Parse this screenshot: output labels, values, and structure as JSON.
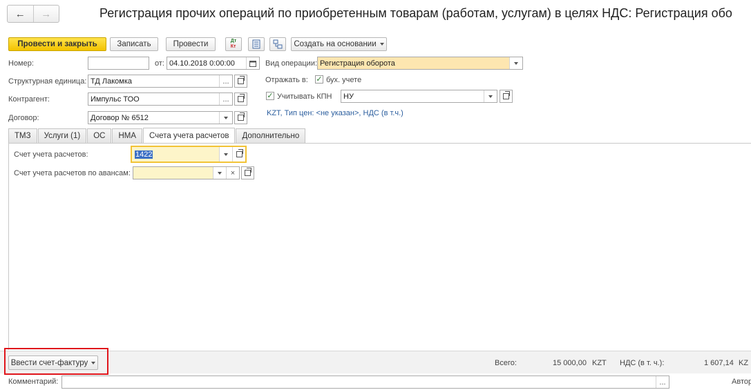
{
  "window": {
    "title": "Регистрация прочих операций по приобретенным товарам (работам, услугам) в целях НДС: Регистрация обо",
    "back_icon": "arrow-left-icon",
    "forward_icon": "arrow-right-icon"
  },
  "toolbar": {
    "post_close": "Провести и закрыть",
    "save": "Записать",
    "post": "Провести",
    "dt_kt_top": "Дт",
    "dt_kt_bottom": "Кт",
    "create_based_on": "Создать на основании"
  },
  "form": {
    "number_label": "Номер:",
    "number_value": "",
    "date_label": "от:",
    "date_value": "04.10.2018  0:00:00",
    "unit_label": "Структурная единица:",
    "unit_value": "ТД Лакомка",
    "contractor_label": "Контрагент:",
    "contractor_value": "Импульс ТОО",
    "contract_label": "Договор:",
    "contract_value": "Договор № 6512",
    "operation_label": "Вид операции:",
    "operation_value": "Регистрация оборота",
    "reflect_label": "Отражать в:",
    "reflect_accounting_label": "бух. учете",
    "reflect_accounting_checked": true,
    "kpn_label": "Учитывать КПН",
    "kpn_checked": true,
    "kpn_value": "НУ",
    "price_info_link": "KZT, Тип цен: <не указан>, НДС (в т.ч.)"
  },
  "tabs": [
    {
      "label": "ТМЗ"
    },
    {
      "label": "Услуги (1)"
    },
    {
      "label": "ОС"
    },
    {
      "label": "НМА"
    },
    {
      "label": "Счета учета расчетов"
    },
    {
      "label": "Дополнительно"
    }
  ],
  "active_tab": 4,
  "settlement": {
    "account_label": "Счет учета расчетов:",
    "account_value": "1422",
    "advance_label": "Счет учета расчетов по авансам:",
    "advance_value": ""
  },
  "footer": {
    "invoice_button": "Ввести счет-фактуру",
    "total_label": "Всего:",
    "total_value": "15 000,00",
    "currency": "KZT",
    "vat_label": "НДС (в т. ч.):",
    "vat_value": "1 607,14",
    "vat_currency_partial": "KZ",
    "comment_label": "Комментарий:",
    "comment_value": "",
    "author_label": "Автор"
  },
  "colors": {
    "primary_button": "#f3c300",
    "highlight": "#e0151b",
    "link": "#2b5e9e",
    "focus_border": "#f2c336",
    "field_yellow": "#fdf5c9"
  }
}
